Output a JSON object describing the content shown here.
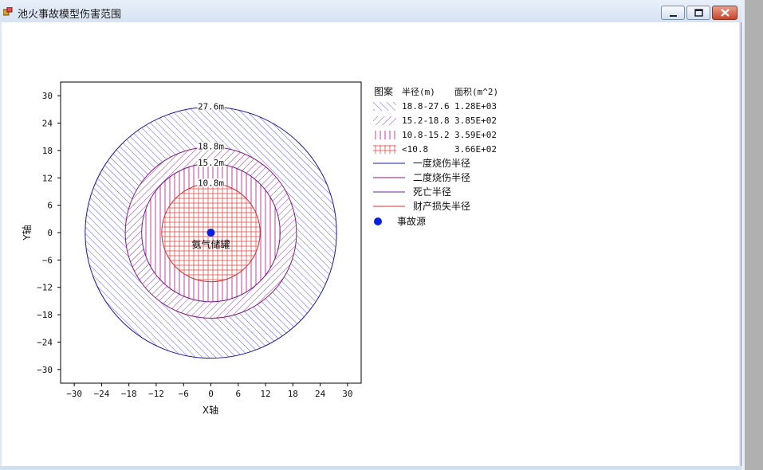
{
  "window": {
    "title": "池火事故模型伤害范围",
    "controls": {
      "minimize": "minimize",
      "maximize": "maximize",
      "close": "close"
    }
  },
  "chart_data": {
    "type": "area",
    "xlabel": "X轴",
    "ylabel": "Y轴",
    "xlim": [
      -33,
      33
    ],
    "ylim": [
      -33,
      33
    ],
    "xticks": [
      -30,
      -24,
      -18,
      -12,
      -6,
      0,
      6,
      12,
      18,
      24,
      30
    ],
    "yticks": [
      30,
      24,
      18,
      12,
      6,
      0,
      -6,
      -12,
      -18,
      -24,
      -30
    ],
    "grid": false,
    "source": {
      "x": 0,
      "y": 0,
      "label": "氨气储罐"
    },
    "circles": [
      {
        "radius": 27.6,
        "label": "27.6m",
        "color": "#1a1aa0"
      },
      {
        "radius": 18.8,
        "label": "18.8m",
        "color": "#8a1a7a"
      },
      {
        "radius": 15.2,
        "label": "15.2m",
        "color": "#7a1a8a"
      },
      {
        "radius": 10.8,
        "label": "10.8m",
        "color": "#d23030"
      }
    ],
    "legend": {
      "placement": "right",
      "headers": {
        "pattern": "图案",
        "radius": "半径(m)",
        "area": "面积(m^2)"
      },
      "rows": [
        {
          "range": "18.8-27.6",
          "area": "1.28E+03",
          "pattern": "diag-blue"
        },
        {
          "range": "15.2-18.8",
          "area": "3.85E+02",
          "pattern": "diag-purple"
        },
        {
          "range": "10.8-15.2",
          "area": "3.59E+02",
          "pattern": "vertical"
        },
        {
          "range": "<10.8",
          "area": "3.66E+02",
          "pattern": "grid"
        }
      ],
      "lines": [
        {
          "label": "一度烧伤半径",
          "color": "#1a1aa0"
        },
        {
          "label": "二度烧伤半径",
          "color": "#8a1a7a"
        },
        {
          "label": "死亡半径",
          "color": "#6a2aa0"
        },
        {
          "label": "财产损失半径",
          "color": "#d23030"
        }
      ],
      "marker_label": "事故源",
      "marker_color": "#0a1ee0"
    }
  }
}
